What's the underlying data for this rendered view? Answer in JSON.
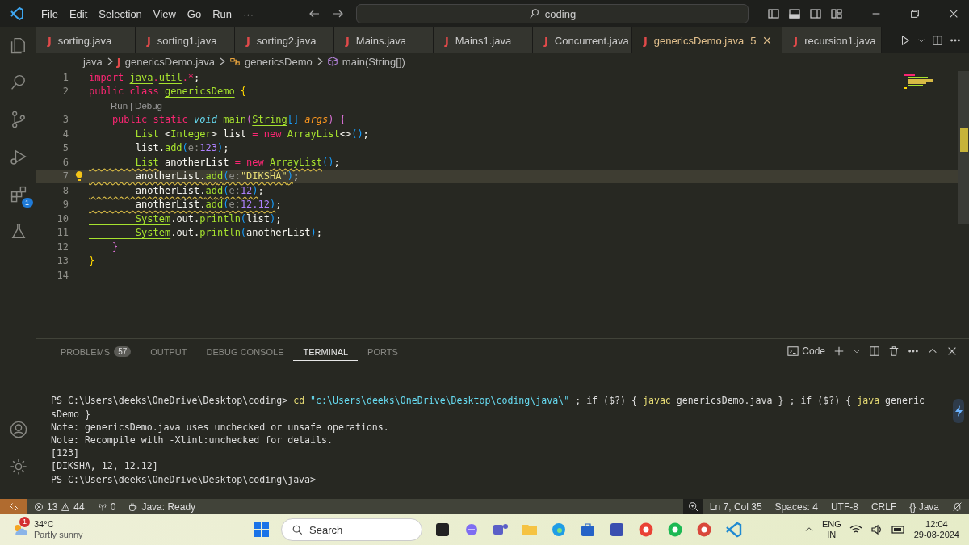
{
  "title_bar": {
    "menu": [
      "File",
      "Edit",
      "Selection",
      "View",
      "Go",
      "Run",
      "···"
    ],
    "search": "coding"
  },
  "activity_bar": {
    "items": [
      {
        "kind": "files",
        "selected": false
      },
      {
        "kind": "search",
        "selected": false
      },
      {
        "kind": "source",
        "selected": false
      },
      {
        "kind": "debug",
        "selected": false
      },
      {
        "kind": "extensions",
        "selected": false,
        "badge": "1"
      },
      {
        "kind": "testing",
        "selected": false
      }
    ],
    "bottom": [
      {
        "kind": "account"
      },
      {
        "kind": "settings"
      }
    ]
  },
  "tabs": [
    {
      "icon": "J",
      "label": "sorting.java",
      "selected": false
    },
    {
      "icon": "J",
      "label": "sorting1.java",
      "selected": false
    },
    {
      "icon": "J",
      "label": "sorting2.java",
      "selected": false
    },
    {
      "icon": "J",
      "label": "Mains.java",
      "selected": false
    },
    {
      "icon": "J",
      "label": "Mains1.java",
      "selected": false
    },
    {
      "icon": "J",
      "label": "Concurrent.java",
      "selected": false
    },
    {
      "icon": "J",
      "label": "genericsDemo.java",
      "selected": true,
      "badge": "5"
    },
    {
      "icon": "J",
      "label": "recursion1.java",
      "selected": false
    }
  ],
  "breadcrumb": [
    {
      "kind": "folder",
      "label": "java"
    },
    {
      "kind": "file",
      "icon": "J",
      "label": "genericsDemo.java"
    },
    {
      "kind": "class",
      "label": "genericsDemo"
    },
    {
      "kind": "method",
      "label": "main(String[])"
    }
  ],
  "code": [
    {
      "kind": "code",
      "number": "1",
      "current": false,
      "lightbulb": false,
      "tokens": [
        {
          "text": "import ",
          "kind": "keyword"
        },
        {
          "text": "java",
          "kind": "type"
        },
        {
          "text": ".",
          "kind": "keyword"
        },
        {
          "text": "util",
          "kind": "type"
        },
        {
          "text": ".*",
          "kind": "keyword"
        },
        {
          "text": ";",
          "kind": "plain"
        }
      ]
    },
    {
      "kind": "code",
      "number": "2",
      "current": false,
      "lightbulb": false,
      "tokens": [
        {
          "text": "public class ",
          "kind": "keyword"
        },
        {
          "text": "genericsDemo",
          "kind": "type"
        },
        {
          "text": " {",
          "kind": "bracket1"
        }
      ]
    },
    {
      "kind": "lens",
      "items": [
        "Run",
        "Debug"
      ],
      "separator": "|"
    },
    {
      "kind": "code",
      "number": "3",
      "current": false,
      "lightbulb": false,
      "tokens": [
        {
          "text": "    public static ",
          "kind": "keyword"
        },
        {
          "text": "void",
          "kind": "storage"
        },
        {
          "text": " main",
          "kind": "method"
        },
        {
          "text": "(",
          "kind": "bracket2"
        },
        {
          "text": "String",
          "kind": "type"
        },
        {
          "text": "[]",
          "kind": "bracket3"
        },
        {
          "text": " args",
          "kind": "param"
        },
        {
          "text": ")",
          "kind": "bracket2"
        },
        {
          "text": " {",
          "kind": "bracket2"
        }
      ]
    },
    {
      "kind": "code",
      "number": "4",
      "current": false,
      "lightbulb": false,
      "tokens": [
        {
          "text": "        List",
          "kind": "type"
        },
        {
          "text": " <",
          "kind": "plain"
        },
        {
          "text": "Integer",
          "kind": "type"
        },
        {
          "text": "> list ",
          "kind": "plain"
        },
        {
          "text": "= new ",
          "kind": "keyword"
        },
        {
          "text": "ArrayList",
          "kind": "class"
        },
        {
          "text": "<>",
          "kind": "plain"
        },
        {
          "text": "()",
          "kind": "bracket3"
        },
        {
          "text": ";",
          "kind": "plain"
        }
      ]
    },
    {
      "kind": "code",
      "number": "5",
      "current": false,
      "lightbulb": false,
      "tokens": [
        {
          "text": "        list.",
          "kind": "plain"
        },
        {
          "text": "add",
          "kind": "method"
        },
        {
          "text": "(",
          "kind": "bracket3"
        },
        {
          "text": "e:",
          "kind": "hint"
        },
        {
          "text": "123",
          "kind": "number"
        },
        {
          "text": ")",
          "kind": "bracket3"
        },
        {
          "text": ";",
          "kind": "plain"
        }
      ]
    },
    {
      "kind": "code",
      "number": "6",
      "current": false,
      "lightbulb": false,
      "tokens": [
        {
          "text": "        List",
          "kind": "type",
          "squiggle": true
        },
        {
          "text": " anotherList ",
          "kind": "plain"
        },
        {
          "text": "= new ",
          "kind": "keyword"
        },
        {
          "text": "ArrayList",
          "kind": "class",
          "squiggle": true
        },
        {
          "text": "()",
          "kind": "bracket3"
        },
        {
          "text": ";",
          "kind": "plain"
        }
      ]
    },
    {
      "kind": "code",
      "number": "7",
      "current": true,
      "lightbulb": true,
      "tokens": [
        {
          "text": "        anotherList.",
          "kind": "plain",
          "squiggle": true
        },
        {
          "text": "add",
          "kind": "method",
          "squiggle": true
        },
        {
          "text": "(",
          "kind": "bracket3",
          "squiggle": true
        },
        {
          "text": "e:",
          "kind": "hint",
          "squiggle": true
        },
        {
          "text": "\"DIKSHA\"",
          "kind": "string",
          "squiggle": true
        },
        {
          "text": ")",
          "kind": "bracket3",
          "squiggle": true
        },
        {
          "text": ";",
          "kind": "plain"
        }
      ]
    },
    {
      "kind": "code",
      "number": "8",
      "current": false,
      "lightbulb": false,
      "tokens": [
        {
          "text": "        anotherList.",
          "kind": "plain",
          "squiggle": true
        },
        {
          "text": "add",
          "kind": "method",
          "squiggle": true
        },
        {
          "text": "(",
          "kind": "bracket3",
          "squiggle": true
        },
        {
          "text": "e:",
          "kind": "hint",
          "squiggle": true
        },
        {
          "text": "12",
          "kind": "number",
          "squiggle": true
        },
        {
          "text": ")",
          "kind": "bracket3",
          "squiggle": true
        },
        {
          "text": ";",
          "kind": "plain"
        }
      ]
    },
    {
      "kind": "code",
      "number": "9",
      "current": false,
      "lightbulb": false,
      "tokens": [
        {
          "text": "        anotherList.",
          "kind": "plain",
          "squiggle": true
        },
        {
          "text": "add",
          "kind": "method",
          "squiggle": true
        },
        {
          "text": "(",
          "kind": "bracket3",
          "squiggle": true
        },
        {
          "text": "e:",
          "kind": "hint",
          "squiggle": true
        },
        {
          "text": "12.12",
          "kind": "number",
          "squiggle": true
        },
        {
          "text": ")",
          "kind": "bracket3",
          "squiggle": true
        },
        {
          "text": ";",
          "kind": "plain"
        }
      ]
    },
    {
      "kind": "code",
      "number": "10",
      "current": false,
      "lightbulb": false,
      "tokens": [
        {
          "text": "        System",
          "kind": "type"
        },
        {
          "text": ".out.",
          "kind": "plain"
        },
        {
          "text": "println",
          "kind": "method"
        },
        {
          "text": "(",
          "kind": "bracket3"
        },
        {
          "text": "list",
          "kind": "plain"
        },
        {
          "text": ")",
          "kind": "bracket3"
        },
        {
          "text": ";",
          "kind": "plain"
        }
      ]
    },
    {
      "kind": "code",
      "number": "11",
      "current": false,
      "lightbulb": false,
      "tokens": [
        {
          "text": "        System",
          "kind": "type"
        },
        {
          "text": ".out.",
          "kind": "plain"
        },
        {
          "text": "println",
          "kind": "method"
        },
        {
          "text": "(",
          "kind": "bracket3"
        },
        {
          "text": "anotherList",
          "kind": "plain"
        },
        {
          "text": ")",
          "kind": "bracket3"
        },
        {
          "text": ";",
          "kind": "plain"
        }
      ]
    },
    {
      "kind": "code",
      "number": "12",
      "current": false,
      "lightbulb": false,
      "tokens": [
        {
          "text": "    }",
          "kind": "bracket2"
        }
      ]
    },
    {
      "kind": "code",
      "number": "13",
      "current": false,
      "lightbulb": false,
      "tokens": [
        {
          "text": "}",
          "kind": "bracket1"
        }
      ]
    },
    {
      "kind": "code",
      "number": "14",
      "current": false,
      "lightbulb": false
    }
  ],
  "panel": {
    "tabs": [
      {
        "label": "PROBLEMS",
        "selected": false,
        "badge": "57"
      },
      {
        "label": "OUTPUT",
        "selected": false
      },
      {
        "label": "DEBUG CONSOLE",
        "selected": false
      },
      {
        "label": "TERMINAL",
        "selected": true
      },
      {
        "label": "PORTS",
        "selected": false
      }
    ],
    "shell": "Code",
    "terminal": [
      [
        {
          "text": "PS C:\\Users\\deeks\\OneDrive\\Desktop\\coding> ",
          "kind": "text"
        },
        {
          "text": "cd",
          "kind": "command"
        },
        {
          "text": " \"c:\\Users\\deeks\\OneDrive\\Desktop\\coding\\java\\\"",
          "kind": "string"
        },
        {
          "text": " ; if ($?) { ",
          "kind": "text"
        },
        {
          "text": "javac",
          "kind": "command"
        },
        {
          "text": " genericsDemo.java } ; if ($?) { ",
          "kind": "text"
        },
        {
          "text": "java",
          "kind": "command"
        },
        {
          "text": " generic",
          "kind": "text"
        }
      ],
      [
        {
          "text": "sDemo }",
          "kind": "text"
        }
      ],
      [
        {
          "text": "Note: genericsDemo.java uses unchecked or unsafe operations.",
          "kind": "text"
        }
      ],
      [
        {
          "text": "Note: Recompile with -Xlint:unchecked for details.",
          "kind": "text"
        }
      ],
      [
        {
          "text": "[123]",
          "kind": "text"
        }
      ],
      [
        {
          "text": "[DIKSHA, 12, 12.12]",
          "kind": "text"
        }
      ],
      [
        {
          "text": "PS C:\\Users\\deeks\\OneDrive\\Desktop\\coding\\java>",
          "kind": "text"
        }
      ]
    ]
  },
  "status_bar": {
    "errors": "13",
    "warnings": "44",
    "ports": "0",
    "java": "Java: Ready",
    "right": [
      "Ln 7, Col 35",
      "Spaces: 4",
      "UTF-8",
      "CRLF",
      "{} Java"
    ]
  },
  "taskbar": {
    "weather": {
      "temp": "34°C",
      "text": "Partly sunny",
      "badge": "1"
    },
    "search": "Search",
    "apps": [
      {
        "kind": "square",
        "color": "#222222"
      },
      {
        "kind": "swirl",
        "color": "#7f6df2"
      },
      {
        "kind": "people",
        "color": "#5b5fc7"
      },
      {
        "kind": "folder",
        "color": "#f5c343"
      },
      {
        "kind": "browser",
        "color": "#1f9de6"
      },
      {
        "kind": "store",
        "color": "#2563c7"
      },
      {
        "kind": "square",
        "color": "#3a4fb0"
      },
      {
        "kind": "circle",
        "color": "#e94235"
      },
      {
        "kind": "circle",
        "color": "#1db954"
      },
      {
        "kind": "circle",
        "color": "#d9483b"
      },
      {
        "kind": "code",
        "color": "#1f8ad2"
      }
    ],
    "lang": "ENG",
    "region": "IN",
    "time": "12:04",
    "date": "29-08-2024"
  }
}
